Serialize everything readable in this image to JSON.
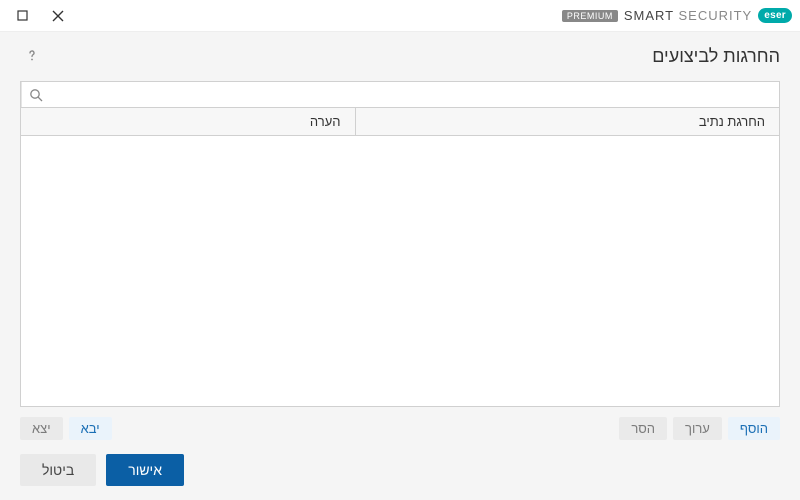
{
  "brand": {
    "badge": "eser",
    "name_strong": "SMART",
    "name_light": "SECURITY",
    "premium": "PREMIUM"
  },
  "page": {
    "title": "החרגות לביצועים"
  },
  "search": {
    "placeholder": ""
  },
  "table": {
    "headers": {
      "path": "החרגת נתיב",
      "comment": "הערה"
    }
  },
  "toolbar": {
    "add": "הוסף",
    "edit": "ערוך",
    "delete": "הסר",
    "import": "יבא",
    "export": "יצא"
  },
  "footer": {
    "ok": "אישור",
    "cancel": "ביטול"
  }
}
